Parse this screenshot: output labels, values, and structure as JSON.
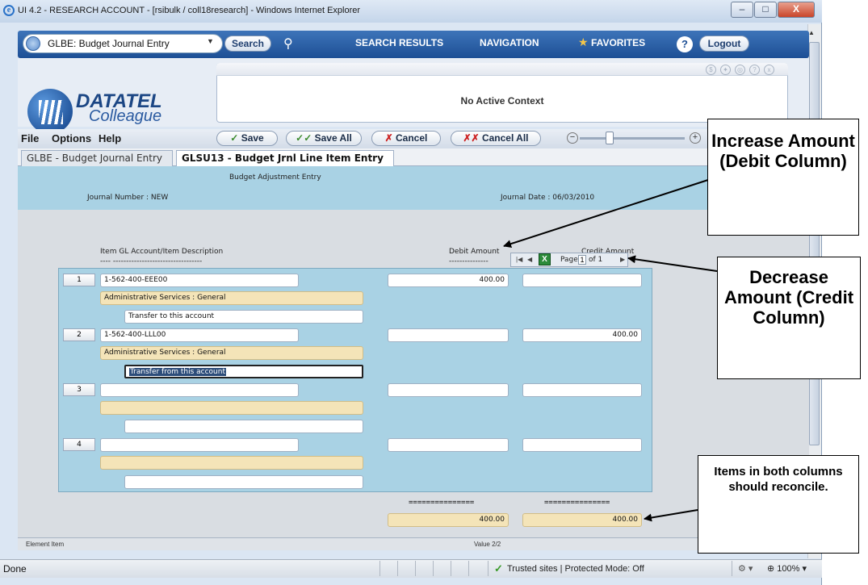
{
  "window": {
    "title": "UI 4.2 - RESEARCH ACCOUNT - [rsibulk / coll18research] - Windows Internet Explorer",
    "min_glyph": "–",
    "max_glyph": "□",
    "close_glyph": "X"
  },
  "nav": {
    "form_select": "GLBE: Budget Journal Entry",
    "search_label": "Search",
    "search_results_label": "SEARCH RESULTS",
    "navigation_label": "NAVIGATION",
    "favorites_label": "FAVORITES",
    "help_glyph": "?",
    "logout_label": "Logout"
  },
  "header": {
    "logo_line1": "DATATEL",
    "logo_line2": "Colleague",
    "context_text": "No Active Context"
  },
  "menu": {
    "file": "File",
    "options": "Options",
    "help": "Help"
  },
  "toolbar": {
    "save": "Save",
    "save_all": "Save All",
    "cancel": "Cancel",
    "cancel_all": "Cancel All"
  },
  "tabs": [
    {
      "label": "GLBE - Budget Journal Entry"
    },
    {
      "label": "GLSU13 - Budget Jrnl Line Item Entry"
    }
  ],
  "form": {
    "title": "Budget Adjustment Entry",
    "journal_number": "Journal Number : NEW",
    "journal_date": "Journal Date : 06/03/2010",
    "col_item": "Item GL Account/Item Description",
    "col_item_dash": "---- ----------------------------------",
    "col_debit": "Debit Amount",
    "col_debit_dash": "---------------",
    "col_credit": "Credit Amount",
    "pager_page": "Page",
    "pager_current": "1",
    "pager_of": "of 1",
    "rows": [
      {
        "num": "1",
        "account": "1-562-400-EEE00",
        "desc": "Administrative Services : General",
        "note": "Transfer to this account",
        "debit": "400.00",
        "credit": ""
      },
      {
        "num": "2",
        "account": "1-562-400-LLL00",
        "desc": "Administrative Services : General",
        "note": "Transfer from this account",
        "debit": "",
        "credit": "400.00"
      },
      {
        "num": "3",
        "account": "",
        "desc": "",
        "note": "",
        "debit": "",
        "credit": ""
      },
      {
        "num": "4",
        "account": "",
        "desc": "",
        "note": "",
        "debit": "",
        "credit": ""
      }
    ],
    "equals_line": "===============",
    "total_debit": "400.00",
    "total_credit": "400.00",
    "footer_left": "Element Item",
    "footer_value": "Value 2/2"
  },
  "statusbar": {
    "done": "Done",
    "zone": "Trusted sites | Protected Mode: Off",
    "zoom": "100%"
  },
  "callouts": {
    "increase": "Increase Amount (Debit Column)",
    "decrease": "Decrease Amount (Credit Column)",
    "reconcile": "Items in both columns should reconcile."
  }
}
